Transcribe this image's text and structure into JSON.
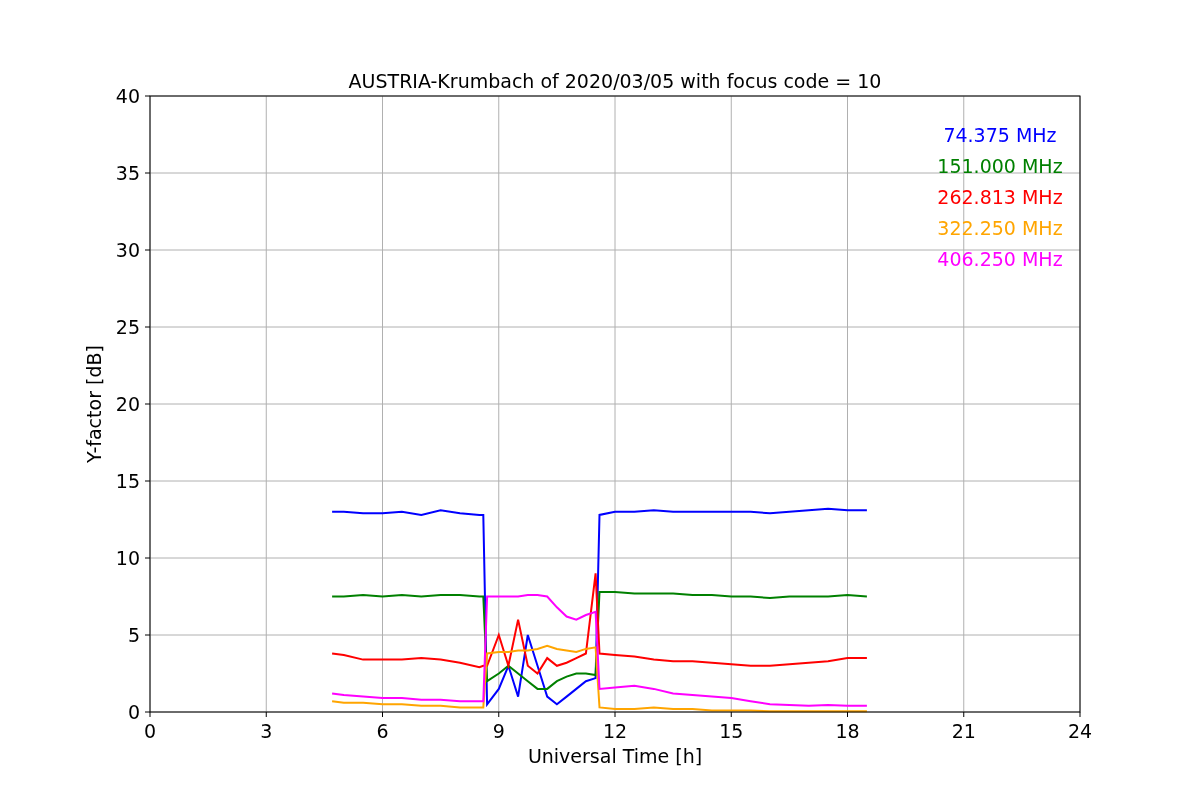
{
  "chart_data": {
    "type": "line",
    "title": "AUSTRIA-Krumbach of 2020/03/05 with focus code = 10",
    "xlabel": "Universal Time [h]",
    "ylabel": "Y-factor [dB]",
    "x": [
      4.7,
      5,
      5.5,
      6,
      6.5,
      7,
      7.5,
      8,
      8.5,
      8.6,
      8.7,
      9,
      9.25,
      9.5,
      9.75,
      10,
      10.25,
      10.5,
      10.75,
      11,
      11.25,
      11.5,
      11.6,
      12,
      12.5,
      13,
      13.5,
      14,
      14.5,
      15,
      15.5,
      16,
      16.5,
      17,
      17.5,
      18,
      18.5
    ],
    "series": [
      {
        "name": "74.375 MHz",
        "color": "#0000ff",
        "values": [
          13,
          13,
          12.9,
          12.9,
          13,
          12.8,
          13.1,
          12.9,
          12.8,
          12.8,
          0.5,
          1.5,
          3,
          1,
          5,
          3,
          1,
          0.5,
          1,
          1.5,
          2,
          2.2,
          12.8,
          13,
          13,
          13.1,
          13,
          13,
          13,
          13,
          13,
          12.9,
          13,
          13.1,
          13.2,
          13.1,
          13.1
        ]
      },
      {
        "name": "151.000 MHz",
        "color": "#008000",
        "values": [
          7.5,
          7.5,
          7.6,
          7.5,
          7.6,
          7.5,
          7.6,
          7.6,
          7.5,
          7.5,
          2,
          2.5,
          3,
          2.5,
          2,
          1.5,
          1.5,
          2,
          2.3,
          2.5,
          2.5,
          2.4,
          7.8,
          7.8,
          7.7,
          7.7,
          7.7,
          7.6,
          7.6,
          7.5,
          7.5,
          7.4,
          7.5,
          7.5,
          7.5,
          7.6,
          7.5
        ]
      },
      {
        "name": "262.813 MHz",
        "color": "#ff0000",
        "values": [
          3.8,
          3.7,
          3.4,
          3.4,
          3.4,
          3.5,
          3.4,
          3.2,
          2.9,
          3.0,
          3,
          5,
          3,
          6,
          3,
          2.5,
          3.5,
          3,
          3.2,
          3.5,
          3.8,
          9,
          3.8,
          3.7,
          3.6,
          3.4,
          3.3,
          3.3,
          3.2,
          3.1,
          3.0,
          3.0,
          3.1,
          3.2,
          3.3,
          3.5,
          3.5
        ]
      },
      {
        "name": "322.250 MHz",
        "color": "#ffa500",
        "values": [
          0.7,
          0.6,
          0.6,
          0.5,
          0.5,
          0.4,
          0.4,
          0.3,
          0.3,
          0.3,
          3.8,
          3.9,
          3.9,
          4,
          4,
          4.1,
          4.3,
          4.1,
          4,
          3.9,
          4.1,
          4.2,
          0.3,
          0.2,
          0.2,
          0.3,
          0.2,
          0.2,
          0.1,
          0.1,
          0.1,
          0.05,
          0.05,
          0.05,
          0.05,
          0.05,
          0.05
        ]
      },
      {
        "name": "406.250 MHz",
        "color": "#ff00ff",
        "values": [
          1.2,
          1.1,
          1.0,
          0.9,
          0.9,
          0.8,
          0.8,
          0.7,
          0.7,
          0.7,
          7.5,
          7.5,
          7.5,
          7.5,
          7.6,
          7.6,
          7.5,
          6.8,
          6.2,
          6.0,
          6.3,
          6.5,
          1.5,
          1.6,
          1.7,
          1.5,
          1.2,
          1.1,
          1.0,
          0.9,
          0.7,
          0.5,
          0.45,
          0.4,
          0.45,
          0.4,
          0.4
        ]
      }
    ],
    "xlim": [
      0,
      24
    ],
    "ylim": [
      0,
      40
    ],
    "xticks": [
      0,
      3,
      6,
      9,
      12,
      15,
      18,
      21,
      24
    ],
    "yticks": [
      0,
      5,
      10,
      15,
      20,
      25,
      30,
      35,
      40
    ],
    "grid": true
  }
}
